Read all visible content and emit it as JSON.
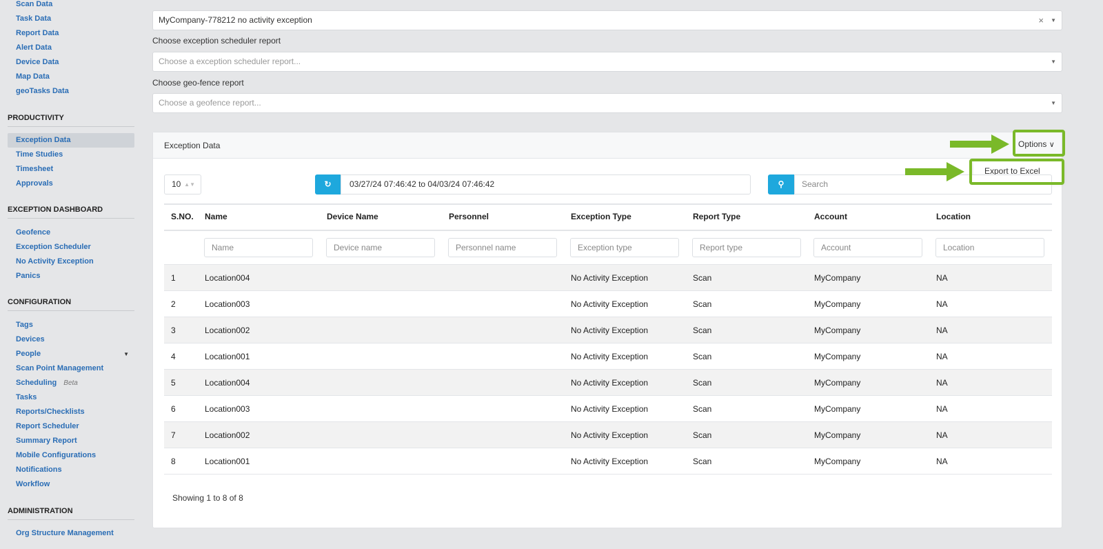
{
  "sidebar": {
    "group0": [
      "Scan Data",
      "Task Data",
      "Report Data",
      "Alert Data",
      "Device Data",
      "Map Data",
      "geoTasks Data"
    ],
    "productivity": {
      "title": "PRODUCTIVITY",
      "items": [
        "Exception Data",
        "Time Studies",
        "Timesheet",
        "Approvals"
      ]
    },
    "exception_dashboard": {
      "title": "EXCEPTION DASHBOARD",
      "items": [
        "Geofence",
        "Exception Scheduler",
        "No Activity Exception",
        "Panics"
      ]
    },
    "configuration": {
      "title": "CONFIGURATION",
      "items": [
        "Tags",
        "Devices",
        "People",
        "Scan Point Management",
        "Scheduling",
        "Tasks",
        "Reports/Checklists",
        "Report Scheduler",
        "Summary Report",
        "Mobile Configurations",
        "Notifications",
        "Workflow"
      ],
      "beta_label": "Beta"
    },
    "administration": {
      "title": "ADMINISTRATION",
      "items": [
        "Org Structure Management"
      ]
    }
  },
  "filters": {
    "report_value": "MyCompany-778212 no activity exception",
    "scheduler_label": "Choose exception scheduler report",
    "scheduler_placeholder": "Choose a exception scheduler report...",
    "geofence_label": "Choose geo-fence report",
    "geofence_placeholder": "Choose a geofence report..."
  },
  "panel": {
    "title": "Exception Data",
    "options_label": "Options",
    "export_label": "Export to Excel",
    "page_size": "10",
    "date_range": "03/27/24 07:46:42 to 04/03/24 07:46:42",
    "search_placeholder": "Search",
    "footer": "Showing 1 to 8 of 8"
  },
  "table": {
    "columns": [
      "S.NO.",
      "Name",
      "Device Name",
      "Personnel",
      "Exception Type",
      "Report Type",
      "Account",
      "Location"
    ],
    "filters": [
      "Name",
      "Device name",
      "Personnel name",
      "Exception type",
      "Report type",
      "Account",
      "Location"
    ],
    "rows": [
      [
        "1",
        "Location004",
        "",
        "",
        "No Activity Exception",
        "Scan",
        "MyCompany",
        "NA"
      ],
      [
        "2",
        "Location003",
        "",
        "",
        "No Activity Exception",
        "Scan",
        "MyCompany",
        "NA"
      ],
      [
        "3",
        "Location002",
        "",
        "",
        "No Activity Exception",
        "Scan",
        "MyCompany",
        "NA"
      ],
      [
        "4",
        "Location001",
        "",
        "",
        "No Activity Exception",
        "Scan",
        "MyCompany",
        "NA"
      ],
      [
        "5",
        "Location004",
        "",
        "",
        "No Activity Exception",
        "Scan",
        "MyCompany",
        "NA"
      ],
      [
        "6",
        "Location003",
        "",
        "",
        "No Activity Exception",
        "Scan",
        "MyCompany",
        "NA"
      ],
      [
        "7",
        "Location002",
        "",
        "",
        "No Activity Exception",
        "Scan",
        "MyCompany",
        "NA"
      ],
      [
        "8",
        "Location001",
        "",
        "",
        "No Activity Exception",
        "Scan",
        "MyCompany",
        "NA"
      ]
    ]
  },
  "colors": {
    "accent": "#1ea8dd",
    "link": "#2a6db5",
    "highlight": "#7ab929"
  }
}
